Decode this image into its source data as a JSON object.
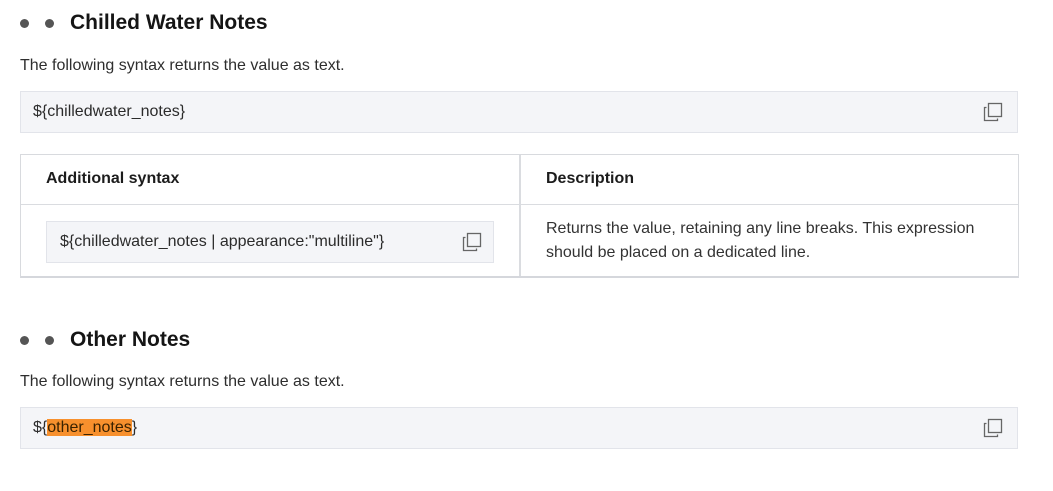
{
  "section1": {
    "heading": "Chilled Water Notes",
    "paragraph": "The following syntax returns the value as text.",
    "code": "${chilledwater_notes}"
  },
  "table": {
    "col1_header": "Additional syntax",
    "col2_header": "Description",
    "row1_code": "${chilledwater_notes | appearance:\"multiline\"}",
    "row1_description": "Returns the value, retaining any line breaks. This expression should be placed on a dedicated line."
  },
  "section2": {
    "heading": "Other Notes",
    "paragraph": "The following syntax returns the value as text.",
    "code_prefix": "${",
    "code_highlight": "other_notes",
    "code_suffix": "}"
  },
  "icons": {
    "copy": "copy-icon",
    "bullet": "bullet-dot"
  },
  "colors": {
    "highlight": "#f7902d",
    "code_bg": "#f4f5f8"
  }
}
